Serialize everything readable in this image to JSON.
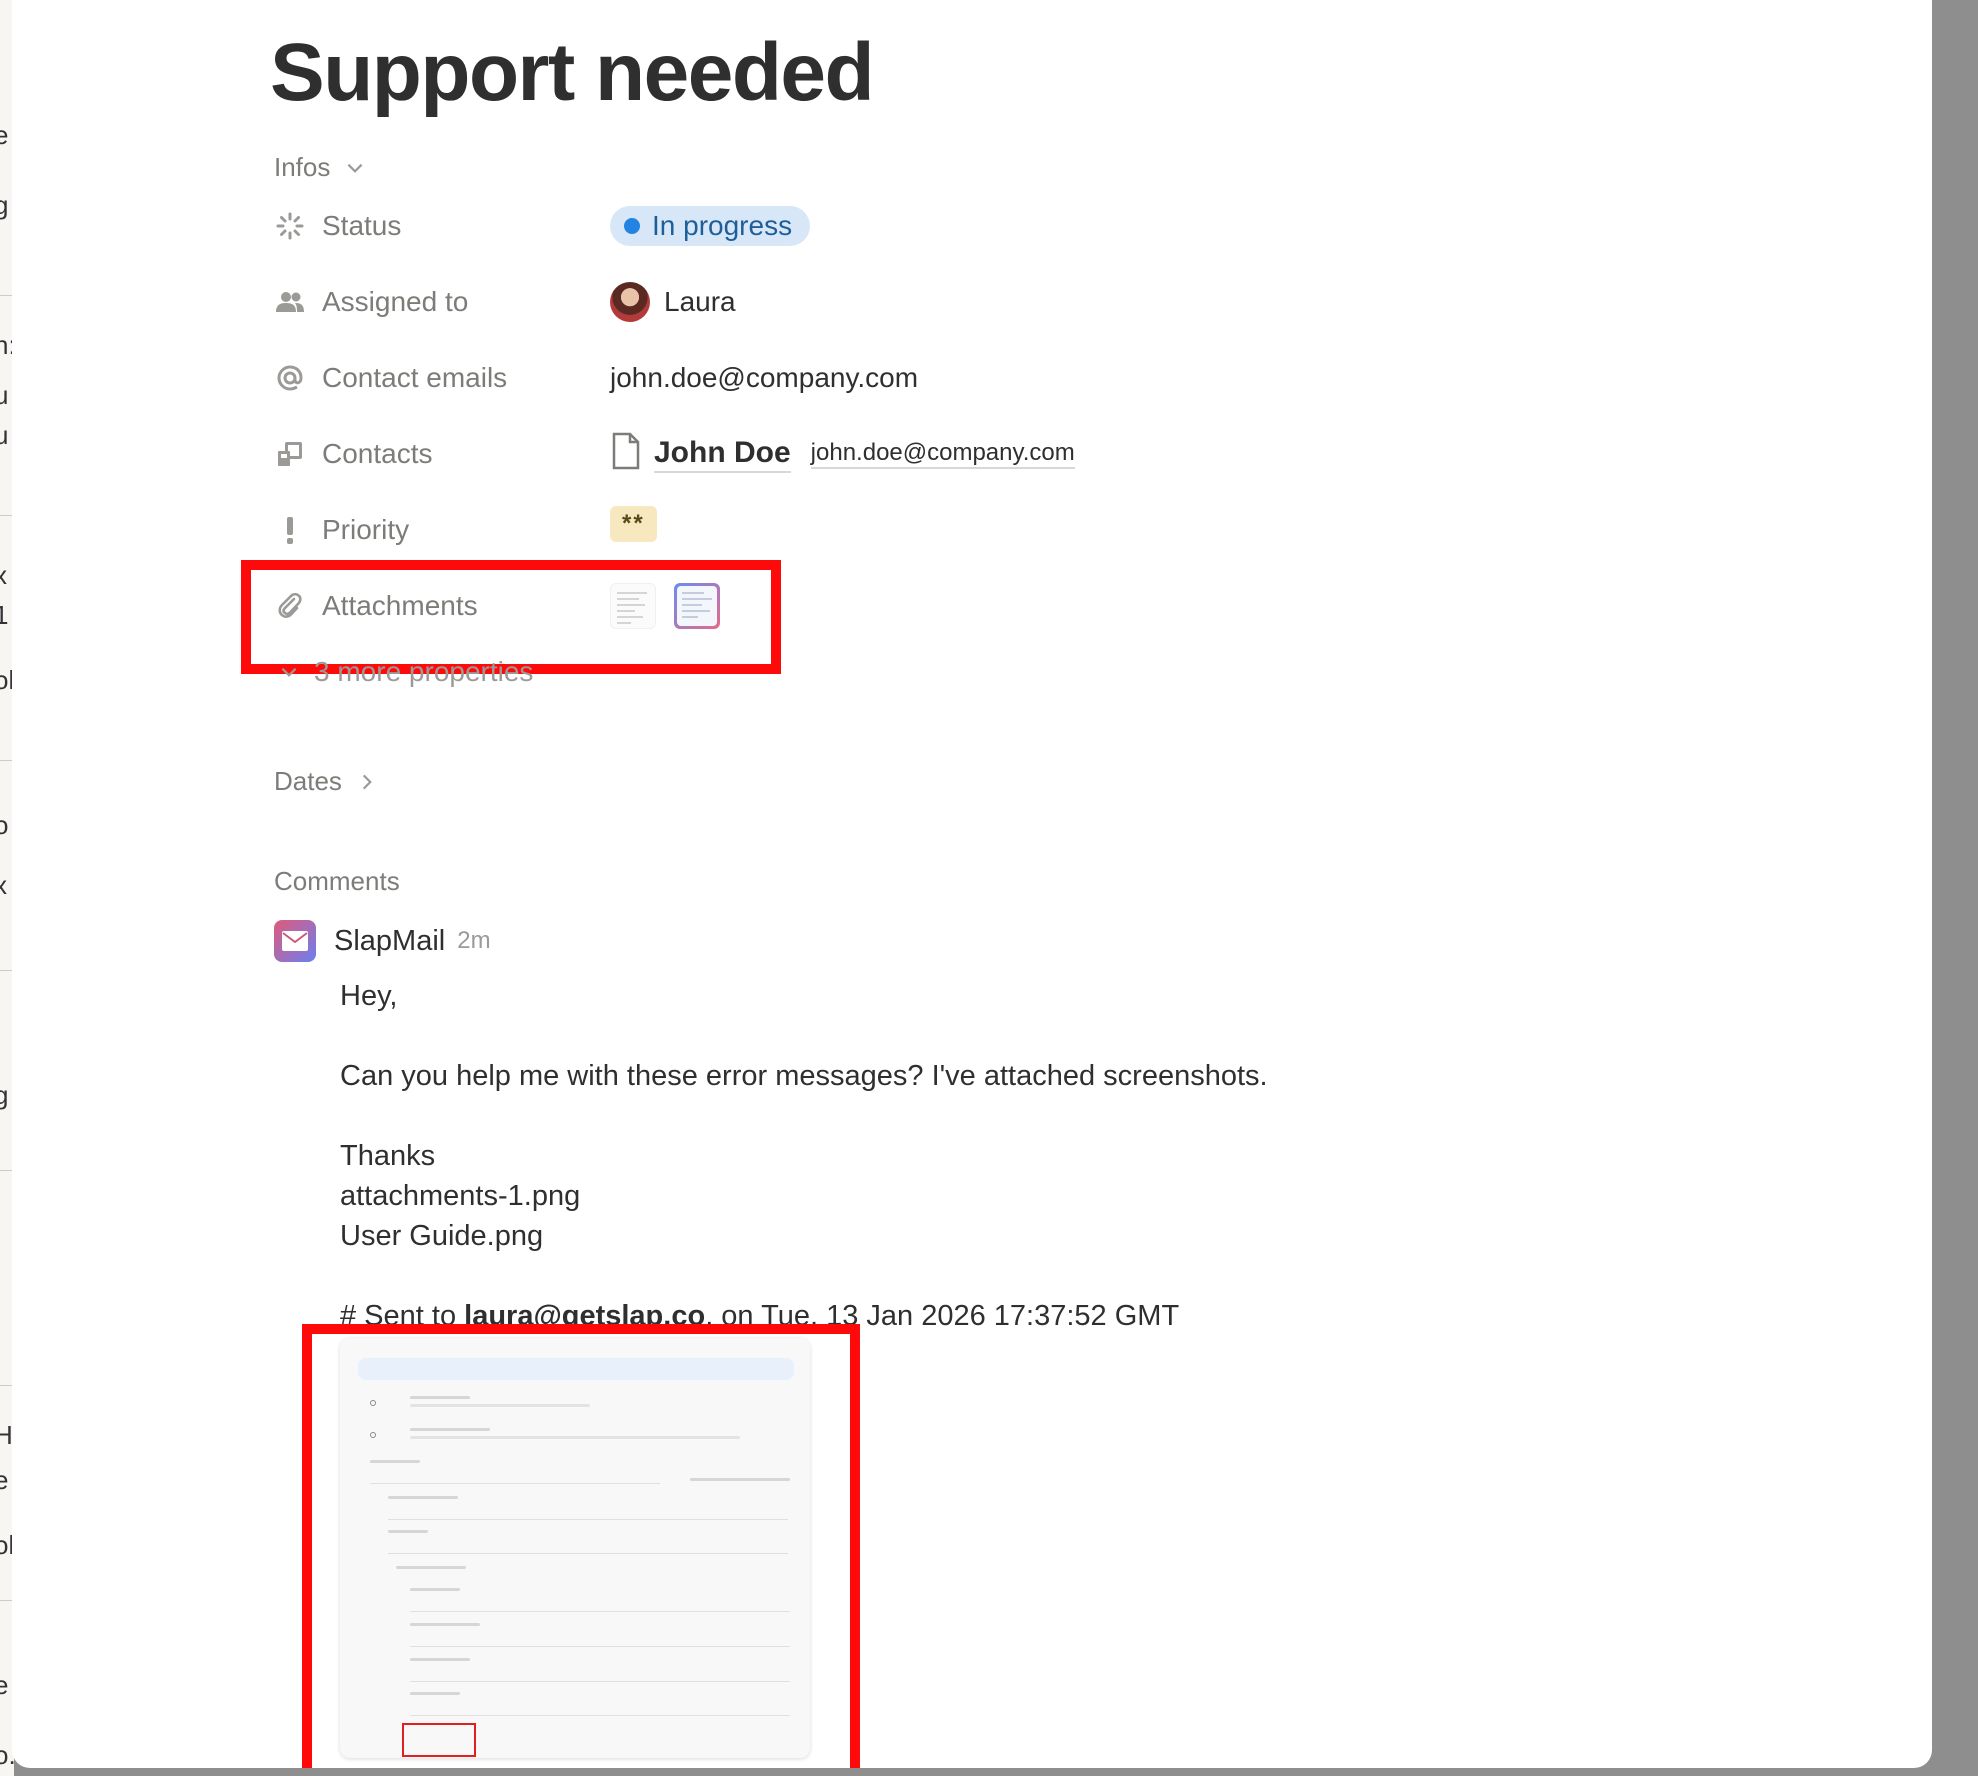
{
  "page": {
    "title": "Support needed"
  },
  "infos": {
    "label": "Infos",
    "properties": [
      {
        "key": "Status",
        "icon": "status-spinner-icon",
        "value": "In progress"
      },
      {
        "key": "Assigned to",
        "icon": "people-icon",
        "value": "Laura"
      },
      {
        "key": "Contact emails",
        "icon": "at-icon",
        "value": "john.doe@company.com"
      },
      {
        "key": "Contacts",
        "icon": "relation-icon",
        "value": "John Doe",
        "secondary": "john.doe@company.com"
      },
      {
        "key": "Priority",
        "icon": "exclamation-icon",
        "value": "**"
      },
      {
        "key": "Attachments",
        "icon": "paperclip-icon",
        "value": ""
      }
    ],
    "more_properties": "3 more properties"
  },
  "dates": {
    "label": "Dates"
  },
  "comments": {
    "label": "Comments",
    "items": [
      {
        "author": "SlapMail",
        "time": "2m",
        "greeting": "Hey,",
        "message": "Can you help me with these error messages? I've attached screenshots.",
        "signoff": "Thanks",
        "attachment_1": "attachments-1.png",
        "attachment_2": "User Guide.png",
        "sent_prefix": "# Sent to ",
        "sent_to": "laura@getslap.co",
        "sent_suffix": ", on Tue, 13 Jan 2026 17:37:52 GMT"
      }
    ]
  },
  "colors": {
    "status_pill_bg": "#d7e7f7",
    "status_dot": "#2383e2",
    "priority_bg": "#f8e8bf",
    "highlight_red": "#ff0a0a"
  }
}
